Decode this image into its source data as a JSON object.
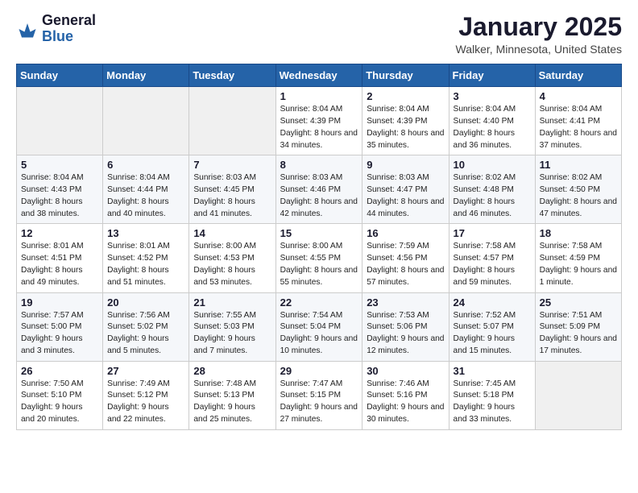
{
  "logo": {
    "general": "General",
    "blue": "Blue"
  },
  "header": {
    "month": "January 2025",
    "location": "Walker, Minnesota, United States"
  },
  "weekdays": [
    "Sunday",
    "Monday",
    "Tuesday",
    "Wednesday",
    "Thursday",
    "Friday",
    "Saturday"
  ],
  "weeks": [
    [
      {
        "day": "",
        "sunrise": "",
        "sunset": "",
        "daylight": ""
      },
      {
        "day": "",
        "sunrise": "",
        "sunset": "",
        "daylight": ""
      },
      {
        "day": "",
        "sunrise": "",
        "sunset": "",
        "daylight": ""
      },
      {
        "day": "1",
        "sunrise": "Sunrise: 8:04 AM",
        "sunset": "Sunset: 4:39 PM",
        "daylight": "Daylight: 8 hours and 34 minutes."
      },
      {
        "day": "2",
        "sunrise": "Sunrise: 8:04 AM",
        "sunset": "Sunset: 4:39 PM",
        "daylight": "Daylight: 8 hours and 35 minutes."
      },
      {
        "day": "3",
        "sunrise": "Sunrise: 8:04 AM",
        "sunset": "Sunset: 4:40 PM",
        "daylight": "Daylight: 8 hours and 36 minutes."
      },
      {
        "day": "4",
        "sunrise": "Sunrise: 8:04 AM",
        "sunset": "Sunset: 4:41 PM",
        "daylight": "Daylight: 8 hours and 37 minutes."
      }
    ],
    [
      {
        "day": "5",
        "sunrise": "Sunrise: 8:04 AM",
        "sunset": "Sunset: 4:43 PM",
        "daylight": "Daylight: 8 hours and 38 minutes."
      },
      {
        "day": "6",
        "sunrise": "Sunrise: 8:04 AM",
        "sunset": "Sunset: 4:44 PM",
        "daylight": "Daylight: 8 hours and 40 minutes."
      },
      {
        "day": "7",
        "sunrise": "Sunrise: 8:03 AM",
        "sunset": "Sunset: 4:45 PM",
        "daylight": "Daylight: 8 hours and 41 minutes."
      },
      {
        "day": "8",
        "sunrise": "Sunrise: 8:03 AM",
        "sunset": "Sunset: 4:46 PM",
        "daylight": "Daylight: 8 hours and 42 minutes."
      },
      {
        "day": "9",
        "sunrise": "Sunrise: 8:03 AM",
        "sunset": "Sunset: 4:47 PM",
        "daylight": "Daylight: 8 hours and 44 minutes."
      },
      {
        "day": "10",
        "sunrise": "Sunrise: 8:02 AM",
        "sunset": "Sunset: 4:48 PM",
        "daylight": "Daylight: 8 hours and 46 minutes."
      },
      {
        "day": "11",
        "sunrise": "Sunrise: 8:02 AM",
        "sunset": "Sunset: 4:50 PM",
        "daylight": "Daylight: 8 hours and 47 minutes."
      }
    ],
    [
      {
        "day": "12",
        "sunrise": "Sunrise: 8:01 AM",
        "sunset": "Sunset: 4:51 PM",
        "daylight": "Daylight: 8 hours and 49 minutes."
      },
      {
        "day": "13",
        "sunrise": "Sunrise: 8:01 AM",
        "sunset": "Sunset: 4:52 PM",
        "daylight": "Daylight: 8 hours and 51 minutes."
      },
      {
        "day": "14",
        "sunrise": "Sunrise: 8:00 AM",
        "sunset": "Sunset: 4:53 PM",
        "daylight": "Daylight: 8 hours and 53 minutes."
      },
      {
        "day": "15",
        "sunrise": "Sunrise: 8:00 AM",
        "sunset": "Sunset: 4:55 PM",
        "daylight": "Daylight: 8 hours and 55 minutes."
      },
      {
        "day": "16",
        "sunrise": "Sunrise: 7:59 AM",
        "sunset": "Sunset: 4:56 PM",
        "daylight": "Daylight: 8 hours and 57 minutes."
      },
      {
        "day": "17",
        "sunrise": "Sunrise: 7:58 AM",
        "sunset": "Sunset: 4:57 PM",
        "daylight": "Daylight: 8 hours and 59 minutes."
      },
      {
        "day": "18",
        "sunrise": "Sunrise: 7:58 AM",
        "sunset": "Sunset: 4:59 PM",
        "daylight": "Daylight: 9 hours and 1 minute."
      }
    ],
    [
      {
        "day": "19",
        "sunrise": "Sunrise: 7:57 AM",
        "sunset": "Sunset: 5:00 PM",
        "daylight": "Daylight: 9 hours and 3 minutes."
      },
      {
        "day": "20",
        "sunrise": "Sunrise: 7:56 AM",
        "sunset": "Sunset: 5:02 PM",
        "daylight": "Daylight: 9 hours and 5 minutes."
      },
      {
        "day": "21",
        "sunrise": "Sunrise: 7:55 AM",
        "sunset": "Sunset: 5:03 PM",
        "daylight": "Daylight: 9 hours and 7 minutes."
      },
      {
        "day": "22",
        "sunrise": "Sunrise: 7:54 AM",
        "sunset": "Sunset: 5:04 PM",
        "daylight": "Daylight: 9 hours and 10 minutes."
      },
      {
        "day": "23",
        "sunrise": "Sunrise: 7:53 AM",
        "sunset": "Sunset: 5:06 PM",
        "daylight": "Daylight: 9 hours and 12 minutes."
      },
      {
        "day": "24",
        "sunrise": "Sunrise: 7:52 AM",
        "sunset": "Sunset: 5:07 PM",
        "daylight": "Daylight: 9 hours and 15 minutes."
      },
      {
        "day": "25",
        "sunrise": "Sunrise: 7:51 AM",
        "sunset": "Sunset: 5:09 PM",
        "daylight": "Daylight: 9 hours and 17 minutes."
      }
    ],
    [
      {
        "day": "26",
        "sunrise": "Sunrise: 7:50 AM",
        "sunset": "Sunset: 5:10 PM",
        "daylight": "Daylight: 9 hours and 20 minutes."
      },
      {
        "day": "27",
        "sunrise": "Sunrise: 7:49 AM",
        "sunset": "Sunset: 5:12 PM",
        "daylight": "Daylight: 9 hours and 22 minutes."
      },
      {
        "day": "28",
        "sunrise": "Sunrise: 7:48 AM",
        "sunset": "Sunset: 5:13 PM",
        "daylight": "Daylight: 9 hours and 25 minutes."
      },
      {
        "day": "29",
        "sunrise": "Sunrise: 7:47 AM",
        "sunset": "Sunset: 5:15 PM",
        "daylight": "Daylight: 9 hours and 27 minutes."
      },
      {
        "day": "30",
        "sunrise": "Sunrise: 7:46 AM",
        "sunset": "Sunset: 5:16 PM",
        "daylight": "Daylight: 9 hours and 30 minutes."
      },
      {
        "day": "31",
        "sunrise": "Sunrise: 7:45 AM",
        "sunset": "Sunset: 5:18 PM",
        "daylight": "Daylight: 9 hours and 33 minutes."
      },
      {
        "day": "",
        "sunrise": "",
        "sunset": "",
        "daylight": ""
      }
    ]
  ]
}
